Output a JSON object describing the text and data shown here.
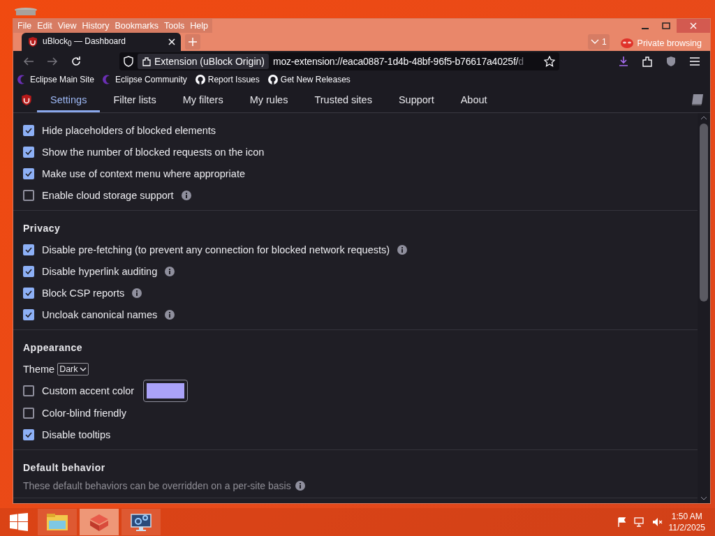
{
  "menu": [
    "File",
    "Edit",
    "View",
    "History",
    "Bookmarks",
    "Tools",
    "Help"
  ],
  "tab": {
    "title": "uBlock$_{0}$ — Dashboard"
  },
  "tab_count": "1",
  "private_label": "Private browsing",
  "urlbar": {
    "identity": "Extension (uBlock Origin)",
    "url": "moz-extension://eaca0887-1d4b-48bf-96f5-b76617a4025f/",
    "url_faded": "d"
  },
  "bookmarks": [
    {
      "kind": "eclipse",
      "label": "Eclipse Main Site"
    },
    {
      "kind": "eclipse",
      "label": "Eclipse Community"
    },
    {
      "kind": "github",
      "label": "Report Issues"
    },
    {
      "kind": "github",
      "label": "Get New Releases"
    }
  ],
  "dashboard_tabs": [
    {
      "label": "Settings",
      "selected": true
    },
    {
      "label": "Filter lists",
      "selected": false
    },
    {
      "label": "My filters",
      "selected": false
    },
    {
      "label": "My rules",
      "selected": false
    },
    {
      "label": "Trusted sites",
      "selected": false
    },
    {
      "label": "Support",
      "selected": false
    },
    {
      "label": "About",
      "selected": false
    }
  ],
  "sections": [
    {
      "items": [
        {
          "kind": "checkbox",
          "label": "Hide placeholders of blocked elements",
          "checked": true,
          "info": false
        },
        {
          "kind": "checkbox",
          "label": "Show the number of blocked requests on the icon",
          "checked": true,
          "info": false
        },
        {
          "kind": "checkbox",
          "label": "Make use of context menu where appropriate",
          "checked": true,
          "info": false
        },
        {
          "kind": "checkbox",
          "label": "Enable cloud storage support",
          "checked": false,
          "info": true
        }
      ]
    },
    {
      "title": "Privacy",
      "items": [
        {
          "kind": "checkbox",
          "label": "Disable pre-fetching (to prevent any connection for blocked network requests)",
          "checked": true,
          "info": true
        },
        {
          "kind": "checkbox",
          "label": "Disable hyperlink auditing",
          "checked": true,
          "info": true
        },
        {
          "kind": "checkbox",
          "label": "Block CSP reports",
          "checked": true,
          "info": true
        },
        {
          "kind": "checkbox",
          "label": "Uncloak canonical names",
          "checked": true,
          "info": true
        }
      ]
    },
    {
      "title": "Appearance",
      "items": [
        {
          "kind": "select",
          "label": "Theme",
          "value": "Dark"
        },
        {
          "kind": "color",
          "label": "Custom accent color",
          "checked": false
        },
        {
          "kind": "checkbox",
          "label": "Color-blind friendly",
          "checked": false,
          "info": false
        },
        {
          "kind": "checkbox",
          "label": "Disable tooltips",
          "checked": true,
          "info": false
        }
      ]
    },
    {
      "title": "Default behavior",
      "items": [
        {
          "kind": "note",
          "label": "These default behaviors can be overridden on a per-site basis",
          "info": true
        }
      ]
    }
  ],
  "taskbar": {
    "apps": [
      {
        "kind": "explorer",
        "selected": false
      },
      {
        "kind": "cube",
        "selected": true
      },
      {
        "kind": "settings",
        "selected": false
      }
    ],
    "time": "1:50 AM",
    "date": "11/2/2025"
  }
}
